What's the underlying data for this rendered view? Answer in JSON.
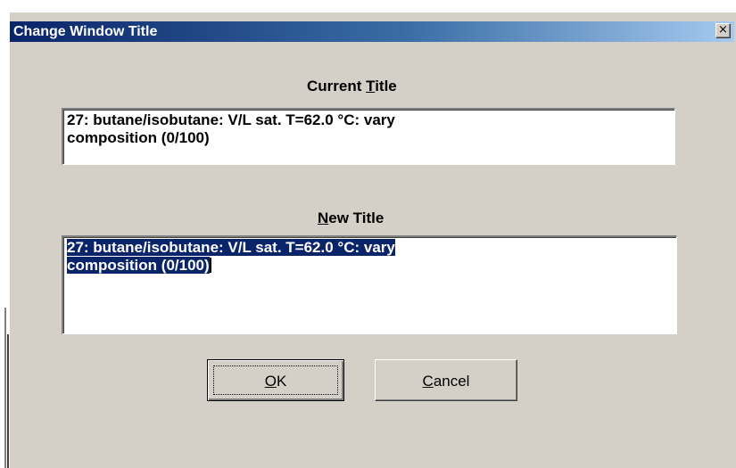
{
  "dialog": {
    "title": "Change Window Title",
    "close_glyph": "×"
  },
  "current_title": {
    "label_pre": "Current ",
    "label_accel": "T",
    "label_post": "itle",
    "lines": [
      "27: butane/isobutane: V/L sat. T=62.0 °C: vary",
      "composition (0/100)"
    ]
  },
  "new_title": {
    "label_accel": "N",
    "label_post": "ew Title",
    "lines": [
      "27: butane/isobutane: V/L sat. T=62.0 °C: vary",
      "composition (0/100)"
    ],
    "selected": true
  },
  "buttons": {
    "ok_accel": "O",
    "ok_post": "K",
    "cancel_accel": "C",
    "cancel_post": "ancel"
  },
  "colors": {
    "dialog_face": "#d4d0c8",
    "titlebar_start": "#0a246a",
    "titlebar_end": "#a6caf0",
    "selection": "#0a246a"
  },
  "icons": {
    "close": "close-icon"
  }
}
